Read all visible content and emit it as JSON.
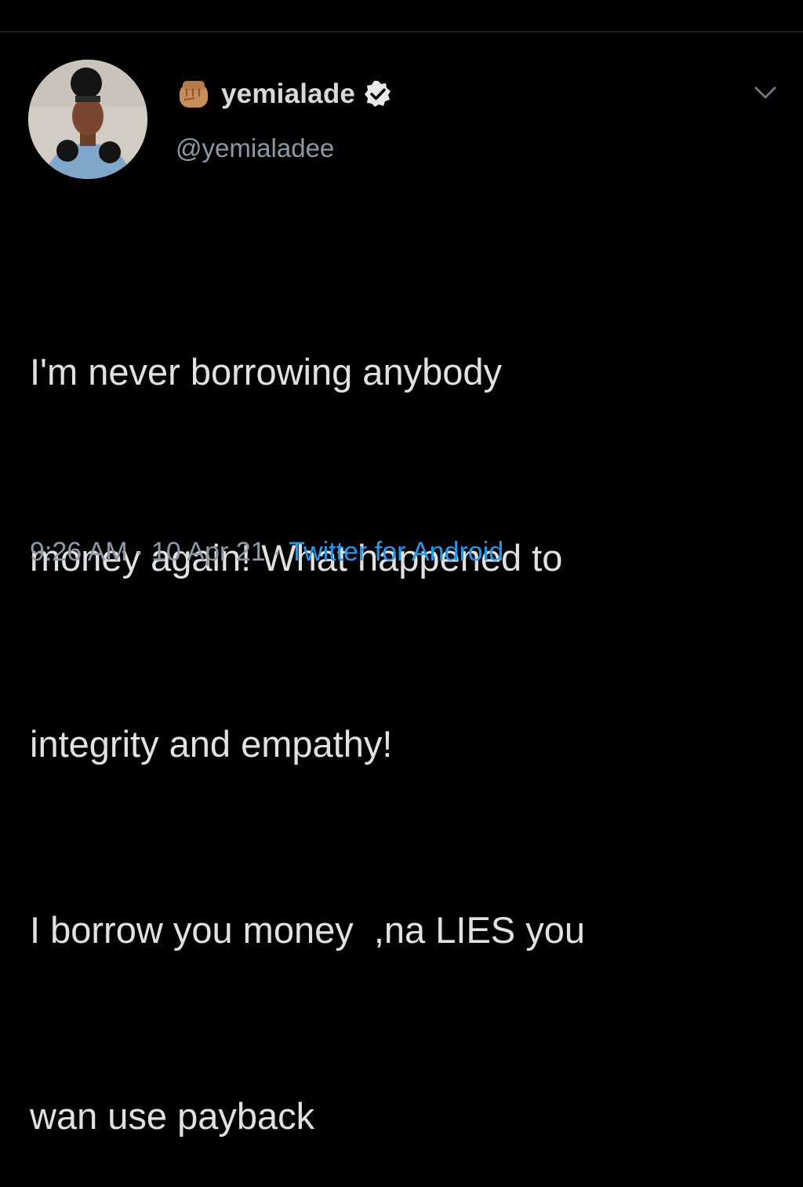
{
  "header": {
    "display_name": "yemialade",
    "handle": "@yemialadee",
    "icons": [
      "fist-emoji-icon",
      "verified-badge-icon",
      "chevron-down-icon"
    ]
  },
  "tweet": {
    "lines": [
      "I'm never borrowing anybody",
      "money again! What happened to",
      "integrity and empathy!",
      "I borrow you money  ,na LIES you",
      "wan use payback"
    ]
  },
  "meta": {
    "time": "9:26 AM",
    "separator": " · ",
    "date": "10 Apr 21",
    "source": "Twitter for Android"
  },
  "colors": {
    "background": "#000000",
    "text": "#e1e1e1",
    "secondary": "#8b98a5",
    "link": "#1d9bf0"
  }
}
